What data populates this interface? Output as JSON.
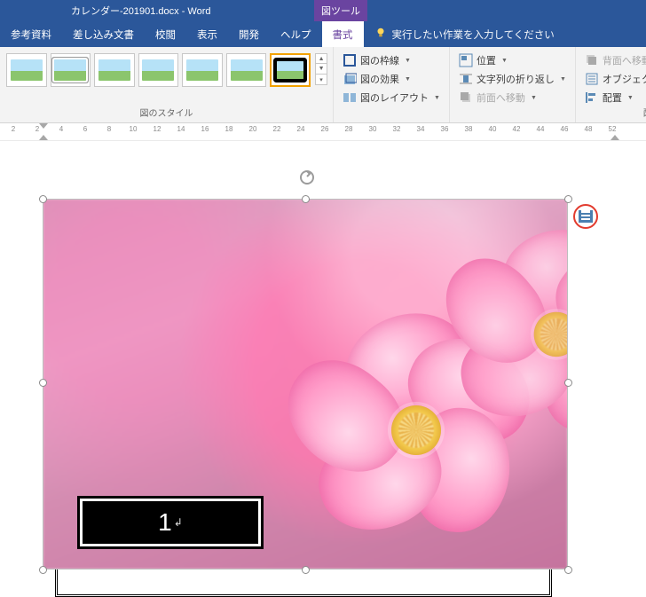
{
  "title": "カレンダー-201901.docx - Word",
  "context_tab": "図ツール",
  "tabs": {
    "references": "参考資料",
    "mailings": "差し込み文書",
    "review": "校閲",
    "view": "表示",
    "developer": "開発",
    "help": "ヘルプ",
    "format": "書式"
  },
  "tellme": "実行したい作業を入力してください",
  "ribbon": {
    "styles_label": "図のスタイル",
    "arrange_label": "配置",
    "pic_border": "図の枠線",
    "pic_effects": "図の効果",
    "pic_layout": "図のレイアウト",
    "position": "位置",
    "wrap": "文字列の折り返し",
    "bring_fwd": "前面へ移動",
    "send_back": "背面へ移動",
    "selection_pane": "オブジェクトの選択と表示",
    "align": "配置"
  },
  "ruler_numbers": [
    "2",
    "2",
    "4",
    "6",
    "8",
    "10",
    "12",
    "14",
    "16",
    "18",
    "20",
    "22",
    "24",
    "26",
    "28",
    "30",
    "32",
    "34",
    "36",
    "38",
    "40",
    "42",
    "44",
    "46",
    "48",
    "52"
  ],
  "month_label": "1",
  "cursor_mark": "↲"
}
